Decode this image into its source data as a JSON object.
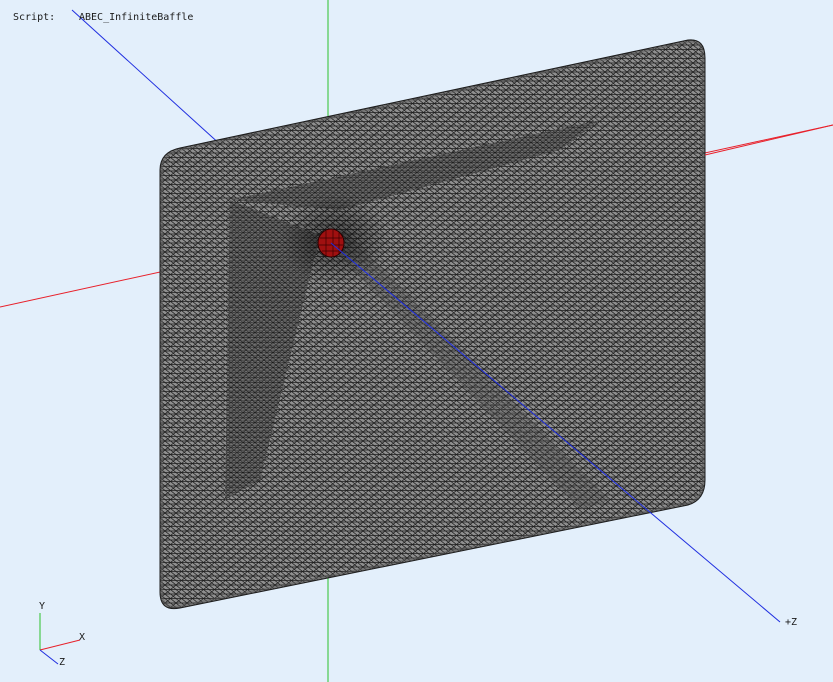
{
  "viewport": {
    "background": "#e3effb",
    "script_label": "Script:",
    "script_name": "ABEC_InfiniteBaffle"
  },
  "axes": {
    "x_color": "#e8202a",
    "y_color": "#2bc02b",
    "z_color": "#1f2ee0",
    "z_plus_label": "+Z"
  },
  "mesh": {
    "face_color": "#909090",
    "edge_color": "#1c1c1c",
    "source_color": "#a01010"
  },
  "triad": {
    "x_label": "X",
    "y_label": "Y",
    "z_label": "Z"
  }
}
